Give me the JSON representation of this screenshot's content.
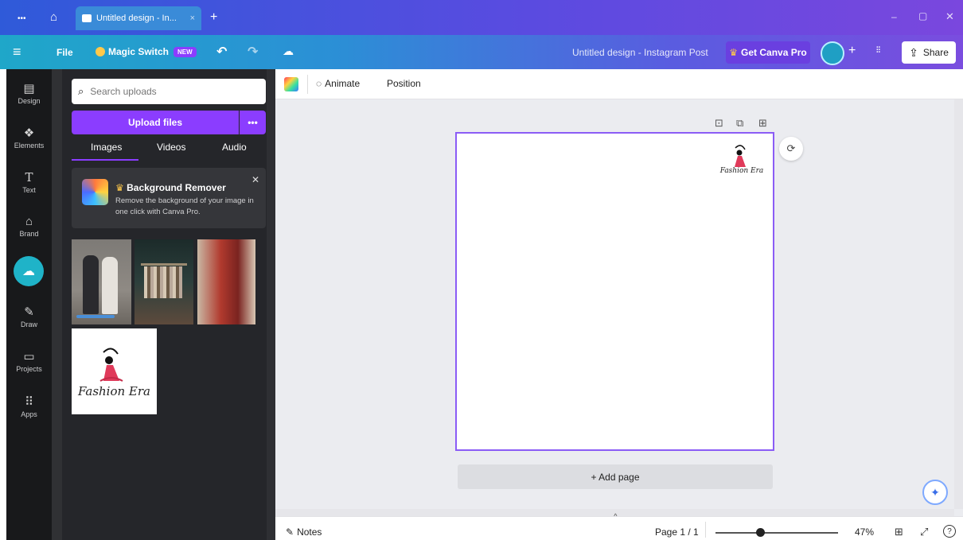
{
  "window": {
    "tab_title": "Untitled design - In...",
    "close_tab": "×",
    "new_tab": "+",
    "more": "•••",
    "minimize": "–",
    "maximize": "▢",
    "close": "✕"
  },
  "menubar": {
    "hamburger": "≡",
    "file": "File",
    "magic_switch": "Magic Switch",
    "new_badge": "NEW",
    "undo": "↶",
    "redo": "↷",
    "doc_title": "Untitled design - Instagram Post",
    "get_pro": "Get Canva Pro",
    "crown": "♛",
    "add_member": "+",
    "insights": "⫶⫶",
    "share": "Share",
    "share_icon": "⇪"
  },
  "rail": {
    "items": [
      {
        "label": "Design",
        "icon": "▤"
      },
      {
        "label": "Elements",
        "icon": "❖"
      },
      {
        "label": "Text",
        "icon": "T"
      },
      {
        "label": "Brand",
        "icon": "⌂"
      },
      {
        "label": "",
        "icon": "☁"
      },
      {
        "label": "Draw",
        "icon": "✎"
      },
      {
        "label": "Projects",
        "icon": "▭"
      },
      {
        "label": "Apps",
        "icon": "⠿"
      }
    ]
  },
  "panel": {
    "search_placeholder": "Search uploads",
    "upload_label": "Upload files",
    "upload_more": "•••",
    "tabs": [
      "Images",
      "Videos",
      "Audio"
    ],
    "promo": {
      "title": "Background Remover",
      "description": "Remove the background of your image in one click with Canva Pro.",
      "close": "✕",
      "crown": "♛"
    },
    "logo_text": "Fashion Era",
    "collapse": "‹"
  },
  "toolbar": {
    "animate": "Animate",
    "position": "Position"
  },
  "canvas": {
    "page_logo_text": "Fashion Era",
    "add_page": "+ Add page",
    "tool_lock": "⊡",
    "tool_duplicate": "⧉",
    "tool_add": "⊞",
    "comment": "⟳"
  },
  "bottombar": {
    "notes": "Notes",
    "page_counter": "Page 1 / 1",
    "zoom": "47%",
    "zoom_fraction": 0.37,
    "grid_icon": "⊞",
    "fullscreen_icon": "⤢",
    "help_icon": "?",
    "up_handle": "^"
  },
  "colors": {
    "brand_purple": "#8b3dff",
    "panel_bg": "#25262a",
    "rail_bg": "#18191b",
    "uploads_active": "#1fb3c8",
    "logo_red": "#e03a5a"
  }
}
